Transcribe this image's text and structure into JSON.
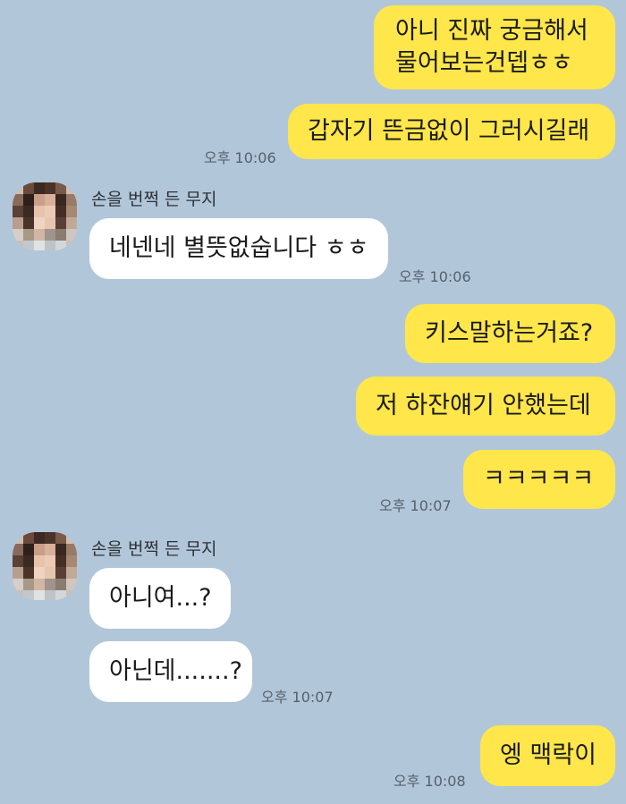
{
  "contact": {
    "name": "손을 번쩍 든 무지"
  },
  "messages": [
    {
      "from": "me",
      "text": "아니 진짜 궁금해서\n물어보는건뎁ㅎㅎ"
    },
    {
      "from": "me",
      "text": "갑자기 뜬금없이 그러시길래",
      "time": "오후 10:06"
    },
    {
      "from": "them",
      "text": "네넨네 별뜻없숩니다 ㅎㅎ",
      "time": "오후 10:06"
    },
    {
      "from": "me",
      "text": "키스말하는거죠?"
    },
    {
      "from": "me",
      "text": "저 하잔얘기 안했는데"
    },
    {
      "from": "me",
      "text": "ㅋㅋㅋㅋㅋ",
      "time": "오후 10:07"
    },
    {
      "from": "them",
      "text": "아니여...?"
    },
    {
      "from": "them",
      "text": "아닌데.......?",
      "time": "오후 10:07"
    },
    {
      "from": "me",
      "text": "엥 맥락이",
      "time": "오후 10:08"
    }
  ],
  "colors": {
    "background": "#b2c6da",
    "my_bubble": "#fee64b",
    "their_bubble": "#ffffff"
  },
  "icons": {
    "avatar": "profile-avatar-pixelated"
  }
}
